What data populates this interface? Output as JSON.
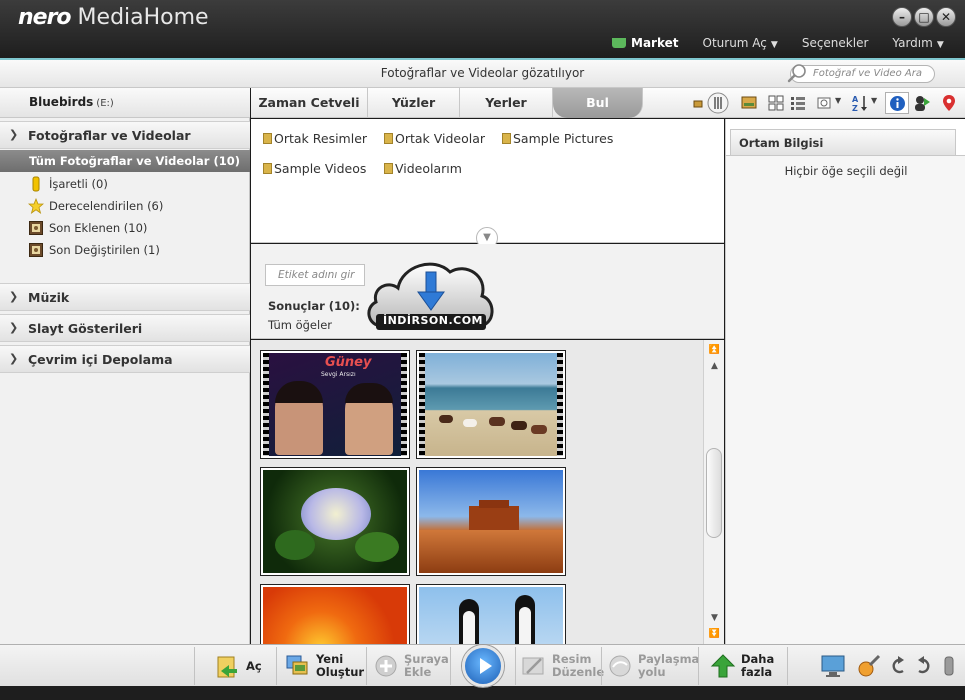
{
  "window": {
    "brand": "nero",
    "app_name": "MediaHome",
    "controls": [
      "minimize",
      "restore",
      "close"
    ]
  },
  "top_nav": {
    "market": "Market",
    "sign_in": "Oturum Aç",
    "options": "Seçenekler",
    "help": "Yardım"
  },
  "status": {
    "text": "Fotoğraflar ve Videolar gözatılıyor",
    "search_placeholder": "Fotoğraf ve Video Ara"
  },
  "sidebar": {
    "drive_name": "Bluebirds",
    "drive_letter": "(E:)",
    "photos_section": "Fotoğraflar ve Videolar",
    "selected_item": "Tüm Fotoğraflar ve Videolar (10)",
    "sub_items": [
      {
        "label": "İşaretli (0)",
        "icon": "marker-icon"
      },
      {
        "label": "Derecelendirilen (6)",
        "icon": "star-icon"
      },
      {
        "label": "Son Eklenen (10)",
        "icon": "photo-frame-icon"
      },
      {
        "label": "Son Değiştirilen (1)",
        "icon": "photo-frame-icon"
      }
    ],
    "sections": [
      "Müzik",
      "Slayt Gösterileri",
      "Çevrim içi Depolama"
    ]
  },
  "tabs": [
    "Zaman Cetveli",
    "Yüzler",
    "Yerler",
    "Bul"
  ],
  "active_tab": "Bul",
  "folders": [
    "Ortak Resimler",
    "Ortak Videolar",
    "Sample Pictures",
    "Sample Videos",
    "Videolarım"
  ],
  "results": {
    "tag_placeholder": "Etiket adını gir",
    "count_label": "Sonuçlar (10):",
    "filter_label": "Tüm öğeler"
  },
  "thumbnail_overlay": {
    "title": "Güney",
    "subtitle": "Sevgi Arsızı"
  },
  "watermark": {
    "text": "İNDİRSON.COM"
  },
  "right_panel": {
    "title": "Ortam Bilgisi",
    "empty_text": "Hiçbir öğe seçili değil"
  },
  "bottom_bar": {
    "open": "Aç",
    "create_new_1": "Yeni",
    "create_new_2": "Oluştur",
    "add_here_1": "Şuraya",
    "add_here_2": "Ekle",
    "edit_image_1": "Resim",
    "edit_image_2": "Düzenle",
    "share_1": "Paylaşma",
    "share_2": "yolu",
    "more_1": "Daha",
    "more_2": "fazla"
  },
  "colors": {
    "accent": "#7fc7cf",
    "selected_bg": "#7a7a7a",
    "titlebar": "#2a2a2a",
    "play_blue": "#2f7ad6",
    "more_green": "#3aa43a"
  }
}
